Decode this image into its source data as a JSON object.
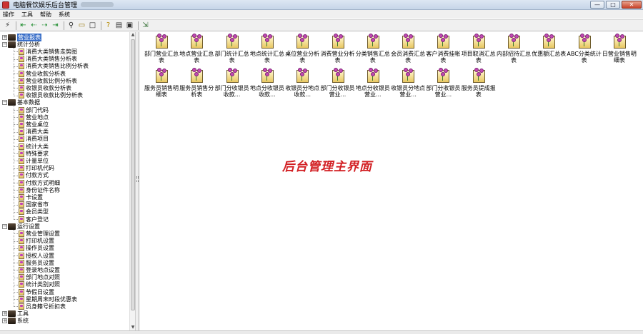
{
  "window": {
    "title": "电脑餐饮娱乐后台管理"
  },
  "window_controls": {
    "minimize": "—",
    "maximize": "□",
    "close": "✕"
  },
  "menu": [
    "操作",
    "工具",
    "帮助",
    "系统"
  ],
  "toolbar": {
    "buttons": [
      {
        "name": "run",
        "glyph": "⚡",
        "color": "#333333"
      },
      {
        "name": "nav-first",
        "glyph": "⇤",
        "color": "#1a8a2a"
      },
      {
        "name": "nav-prev",
        "glyph": "⇠",
        "color": "#1a8a2a"
      },
      {
        "name": "nav-next",
        "glyph": "⇢",
        "color": "#1a8a2a"
      },
      {
        "name": "nav-last",
        "glyph": "⇥",
        "color": "#1a8a2a"
      },
      {
        "name": "find",
        "glyph": "⚲",
        "color": "#333333"
      },
      {
        "name": "open",
        "glyph": "▭",
        "color": "#9a7a10"
      },
      {
        "name": "new",
        "glyph": "□",
        "color": "#333333"
      },
      {
        "name": "help",
        "glyph": "?",
        "color": "#b58a00"
      },
      {
        "name": "calc",
        "glyph": "▤",
        "color": "#333333"
      },
      {
        "name": "display",
        "glyph": "▣",
        "color": "#333333"
      },
      {
        "name": "exit",
        "glyph": "⇲",
        "color": "#2c6a2c"
      }
    ]
  },
  "tree": {
    "nodes": [
      {
        "label": "营业报表",
        "level": 0,
        "expander": "+",
        "selected": true
      },
      {
        "label": "统计分析",
        "level": 0,
        "expander": "−",
        "selected": false
      },
      {
        "label": "消费大类销售走势图",
        "level": 1
      },
      {
        "label": "消费大类销售分析表",
        "level": 1
      },
      {
        "label": "消费大类销售比例分析表",
        "level": 1
      },
      {
        "label": "营业收款分析表",
        "level": 1
      },
      {
        "label": "营业收款比例分析表",
        "level": 1
      },
      {
        "label": "收银员收款分析表",
        "level": 1
      },
      {
        "label": "收银员收款比例分析表",
        "level": 1
      },
      {
        "label": "基本数据",
        "level": 0,
        "expander": "−",
        "selected": false
      },
      {
        "label": "部门代码",
        "level": 1
      },
      {
        "label": "营业地点",
        "level": 1
      },
      {
        "label": "营业桌位",
        "level": 1
      },
      {
        "label": "消费大类",
        "level": 1
      },
      {
        "label": "消费项目",
        "level": 1
      },
      {
        "label": "统计大类",
        "level": 1
      },
      {
        "label": "特殊要求",
        "level": 1
      },
      {
        "label": "计量单位",
        "level": 1
      },
      {
        "label": "打印机代码",
        "level": 1
      },
      {
        "label": "付款方式",
        "level": 1
      },
      {
        "label": "付款方式明细",
        "level": 1
      },
      {
        "label": "身份证件名称",
        "level": 1
      },
      {
        "label": "卡设置",
        "level": 1
      },
      {
        "label": "国家省市",
        "level": 1
      },
      {
        "label": "会员类型",
        "level": 1
      },
      {
        "label": "客户登记",
        "level": 1
      },
      {
        "label": "运行设置",
        "level": 0,
        "expander": "−",
        "selected": false
      },
      {
        "label": "营业管理设置",
        "level": 1
      },
      {
        "label": "打印机设置",
        "level": 1
      },
      {
        "label": "操作员设置",
        "level": 1
      },
      {
        "label": "授权人设置",
        "level": 1
      },
      {
        "label": "服务员设置",
        "level": 1
      },
      {
        "label": "登录地点设置",
        "level": 1
      },
      {
        "label": "部门地点对照",
        "level": 1
      },
      {
        "label": "统计类别对照",
        "level": 1
      },
      {
        "label": "节假日设置",
        "level": 1
      },
      {
        "label": "星期周末时段优惠表",
        "level": 1
      },
      {
        "label": "员身籍号折扣表",
        "level": 1
      },
      {
        "label": "工具",
        "level": 0,
        "expander": "+",
        "selected": false
      },
      {
        "label": "系统",
        "level": 0,
        "expander": "+",
        "selected": false
      }
    ]
  },
  "tree_scrollbar": {
    "up_arrow": "▲",
    "down_arrow": "▼"
  },
  "tiles": [
    [
      "部门营业汇总表",
      "地点营业汇总表",
      "部门统计汇总表",
      "地点统计汇总表",
      "桌位营业分析表",
      "消费营业分析表",
      "分类销售汇总表",
      "会员消费汇总表",
      "客户消费挂帐表",
      "项目取消汇总表",
      "内部招待汇总表",
      "优惠额汇总表",
      "ABC分类统计表",
      "日营业销售明细表"
    ],
    [
      "服务员销售明细表",
      "服务员销售分析表",
      "部门分收银员收款...",
      "地点分收银员收款...",
      "收银员分地点收款...",
      "部门分收银员营业...",
      "地点分收银员营业...",
      "收银员分地点营业...",
      "部门分收银员营业...",
      "服务员提成报表"
    ]
  ],
  "main": {
    "heading": "后台管理主界面"
  }
}
